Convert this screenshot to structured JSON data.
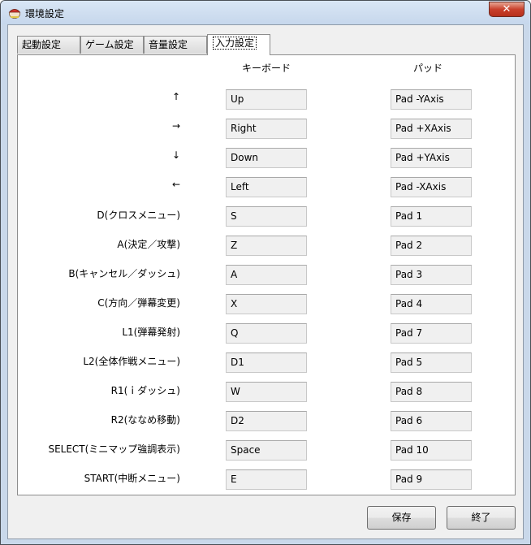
{
  "window": {
    "title": "環境設定",
    "close_label": "✕"
  },
  "tabs": [
    {
      "label": "起動設定"
    },
    {
      "label": "ゲーム設定"
    },
    {
      "label": "音量設定"
    },
    {
      "label": "入力設定",
      "active": true
    }
  ],
  "columns": {
    "keyboard": "キーボード",
    "pad": "パッド"
  },
  "rows": [
    {
      "label": "↑",
      "key": "Up",
      "pad": "Pad -YAxis"
    },
    {
      "label": "→",
      "key": "Right",
      "pad": "Pad +XAxis"
    },
    {
      "label": "↓",
      "key": "Down",
      "pad": "Pad +YAxis"
    },
    {
      "label": "←",
      "key": "Left",
      "pad": "Pad -XAxis"
    },
    {
      "label": "D(クロスメニュー)",
      "key": "S",
      "pad": "Pad 1"
    },
    {
      "label": "A(決定／攻撃)",
      "key": "Z",
      "pad": "Pad 2"
    },
    {
      "label": "B(キャンセル／ダッシュ)",
      "key": "A",
      "pad": "Pad 3"
    },
    {
      "label": "C(方向／弾幕変更)",
      "key": "X",
      "pad": "Pad 4"
    },
    {
      "label": "L1(弾幕発射)",
      "key": "Q",
      "pad": "Pad 7"
    },
    {
      "label": "L2(全体作戦メニュー)",
      "key": "D1",
      "pad": "Pad 5"
    },
    {
      "label": "R1(ｉダッシュ)",
      "key": "W",
      "pad": "Pad 8"
    },
    {
      "label": "R2(ななめ移動)",
      "key": "D2",
      "pad": "Pad 6"
    },
    {
      "label": "SELECT(ミニマップ強調表示)",
      "key": "Space",
      "pad": "Pad 10"
    },
    {
      "label": "START(中断メニュー)",
      "key": "E",
      "pad": "Pad 9"
    }
  ],
  "buttons": {
    "save": "保存",
    "exit": "終了"
  },
  "icons": {
    "app": "yukkuri-app-icon",
    "close": "close-icon"
  },
  "colors": {
    "titlebar": "#c6d7ec",
    "close": "#c9402c",
    "client": "#f0f0f0"
  }
}
